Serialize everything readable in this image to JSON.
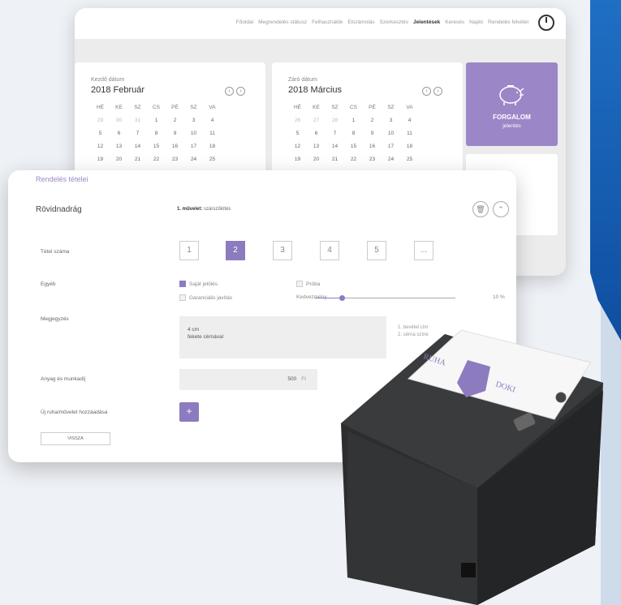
{
  "nav": {
    "items": [
      "Főoldal",
      "Megrendelés státusz",
      "Felhasználók",
      "Elszámolás",
      "Szerkesztés",
      "Jelentések",
      "Keresés",
      "Napló",
      "Rendelés felvétel"
    ],
    "active_index": 5
  },
  "calendar_start": {
    "label": "Kezdő dátum",
    "month": "2018 Február",
    "weekdays": [
      "HÉ",
      "KE",
      "SZ",
      "CS",
      "PÉ",
      "SZ",
      "VA"
    ],
    "days": [
      [
        "29",
        "30",
        "31",
        "1",
        "2",
        "3",
        "4"
      ],
      [
        "5",
        "6",
        "7",
        "8",
        "9",
        "10",
        "11"
      ],
      [
        "12",
        "13",
        "14",
        "15",
        "16",
        "17",
        "18"
      ],
      [
        "19",
        "20",
        "21",
        "22",
        "23",
        "24",
        "25"
      ]
    ],
    "muted_first_row": 3
  },
  "calendar_end": {
    "label": "Záró dátum",
    "month": "2018 Március",
    "weekdays": [
      "HÉ",
      "KE",
      "SZ",
      "CS",
      "PÉ",
      "SZ",
      "VA"
    ],
    "days": [
      [
        "26",
        "27",
        "28",
        "1",
        "2",
        "3",
        "4"
      ],
      [
        "5",
        "6",
        "7",
        "8",
        "9",
        "10",
        "11"
      ],
      [
        "12",
        "13",
        "14",
        "15",
        "16",
        "17",
        "18"
      ],
      [
        "19",
        "20",
        "21",
        "22",
        "23",
        "24",
        "25"
      ]
    ],
    "muted_first_row": 3
  },
  "report_card": {
    "title": "FORGALOM",
    "subtitle": "jelentés"
  },
  "order": {
    "section_title": "Rendelés tételei",
    "item_name": "Rövidnadrág",
    "operation_prefix": "1. művelet:",
    "operation_name": "szárszűkítés",
    "item_count_label": "Tétel száma",
    "item_numbers": [
      "1",
      "2",
      "3",
      "4",
      "5",
      "..."
    ],
    "selected_number": "2",
    "other_label": "Egyéb",
    "own_label": "Saját jelölés",
    "warranty_label": "Garanciális javítás",
    "trial_label": "Próba",
    "discount_label": "Kedvezmény",
    "discount_value": "10 %",
    "discount_fraction": 0.15,
    "note_label": "Megjegyzés",
    "note_line1": "4 cm",
    "note_line2": "fekete cérnával",
    "hint_line1": "1. bevétel cím",
    "hint_line2": "2. cérna színe",
    "material_label": "Anyag és munkadíj",
    "material_value": "500",
    "currency": "Ft",
    "add_label": "Új ruha/művelet hozzáadása",
    "add_symbol": "+",
    "back_label": "VISSZA"
  },
  "receipt": {
    "brand_left": "RUHA",
    "brand_right": "DOKI"
  },
  "colors": {
    "accent": "#8d7bbf",
    "blue": "#1f6fc4"
  }
}
